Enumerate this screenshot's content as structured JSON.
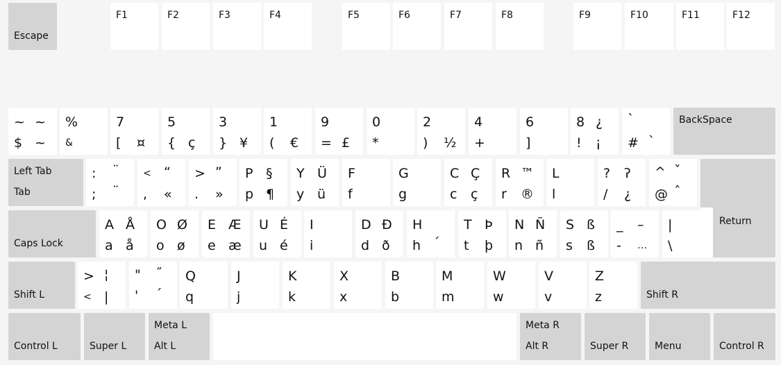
{
  "fkeys": {
    "escape": "Escape",
    "f1": "F1",
    "f2": "F2",
    "f3": "F3",
    "f4": "F4",
    "f5": "F5",
    "f6": "F6",
    "f7": "F7",
    "f8": "F8",
    "f9": "F9",
    "f10": "F10",
    "f11": "F11",
    "f12": "F12"
  },
  "row_number": {
    "k1": {
      "tl": "~",
      "tr": "~",
      "bl": "$",
      "br": "~"
    },
    "k2": {
      "tl": "%",
      "tr": "",
      "bl": "&",
      "br": ""
    },
    "k3": {
      "tl": "7",
      "tr": "",
      "bl": "[",
      "br": "¤"
    },
    "k4": {
      "tl": "5",
      "tr": "",
      "bl": "{",
      "br": "ç"
    },
    "k5": {
      "tl": "3",
      "tr": "",
      "bl": "}",
      "br": "¥"
    },
    "k6": {
      "tl": "1",
      "tr": "",
      "bl": "(",
      "br": "€"
    },
    "k7": {
      "tl": "9",
      "tr": "",
      "bl": "=",
      "br": "£"
    },
    "k8": {
      "tl": "0",
      "tr": "",
      "bl": "*",
      "br": ""
    },
    "k9": {
      "tl": "2",
      "tr": "",
      "bl": ")",
      "br": "½"
    },
    "k10": {
      "tl": "4",
      "tr": "",
      "bl": "+",
      "br": ""
    },
    "k11": {
      "tl": "6",
      "tr": "",
      "bl": "]",
      "br": ""
    },
    "k12": {
      "tl": "8",
      "tr": "¿",
      "bl": "!",
      "br": "¡"
    },
    "k13": {
      "tl": "`",
      "tr": "",
      "bl": "#",
      "br": "`"
    },
    "backspace": "BackSpace"
  },
  "row_top": {
    "tab_top": "Left Tab",
    "tab_bottom": "Tab",
    "k1": {
      "tl": ":",
      "tr": "¨",
      "bl": ";",
      "br": "¨"
    },
    "k2": {
      "tl": "<",
      "tr": "“",
      "bl": ",",
      "br": "«"
    },
    "k3": {
      "tl": ">",
      "tr": "”",
      "bl": ".",
      "br": "»"
    },
    "k4": {
      "tl": "P",
      "tr": "§",
      "bl": "p",
      "br": "¶"
    },
    "k5": {
      "tl": "Y",
      "tr": "Ü",
      "bl": "y",
      "br": "ü"
    },
    "k6": {
      "tl": "F",
      "tr": "",
      "bl": "f",
      "br": ""
    },
    "k7": {
      "tl": "G",
      "tr": "",
      "bl": "g",
      "br": ""
    },
    "k8": {
      "tl": "C",
      "tr": "Ç",
      "bl": "c",
      "br": "ç"
    },
    "k9": {
      "tl": "R",
      "tr": "™",
      "bl": "r",
      "br": "®"
    },
    "k10": {
      "tl": "L",
      "tr": "",
      "bl": "l",
      "br": ""
    },
    "k11": {
      "tl": "?",
      "tr": "ʔ",
      "bl": "/",
      "br": "¿"
    },
    "k12": {
      "tl": "^",
      "tr": "ˇ",
      "bl": "@",
      "br": "ˆ"
    }
  },
  "row_home": {
    "caps": "Caps Lock",
    "k1": {
      "tl": "A",
      "tr": "Å",
      "bl": "a",
      "br": "å"
    },
    "k2": {
      "tl": "O",
      "tr": "Ø",
      "bl": "o",
      "br": "ø"
    },
    "k3": {
      "tl": "E",
      "tr": "Æ",
      "bl": "e",
      "br": "æ"
    },
    "k4": {
      "tl": "U",
      "tr": "É",
      "bl": "u",
      "br": "é"
    },
    "k5": {
      "tl": "I",
      "tr": "",
      "bl": "i",
      "br": ""
    },
    "k6": {
      "tl": "D",
      "tr": "Đ",
      "bl": "d",
      "br": "ð"
    },
    "k7": {
      "tl": "H",
      "tr": "",
      "bl": "h",
      "br": "´"
    },
    "k8": {
      "tl": "T",
      "tr": "Þ",
      "bl": "t",
      "br": "þ"
    },
    "k9": {
      "tl": "N",
      "tr": "Ñ",
      "bl": "n",
      "br": "ñ"
    },
    "k10": {
      "tl": "S",
      "tr": "ß",
      "bl": "s",
      "br": "ß"
    },
    "k11": {
      "tl": "_",
      "tr": "–",
      "bl": "-",
      "br": "…"
    },
    "k12": {
      "tl": "|",
      "tr": "",
      "bl": "\\",
      "br": ""
    },
    "return": "Return"
  },
  "row_bottom": {
    "shift_l": "Shift L",
    "k1": {
      "tl": ">",
      "tr": "¦",
      "bl": "<",
      "br": "|"
    },
    "k2": {
      "tl": "\"",
      "tr": "˝",
      "bl": "'",
      "br": "´"
    },
    "k3": {
      "tl": "Q",
      "tr": "",
      "bl": "q",
      "br": ""
    },
    "k4": {
      "tl": "J",
      "tr": "",
      "bl": "j",
      "br": ""
    },
    "k5": {
      "tl": "K",
      "tr": "",
      "bl": "k",
      "br": ""
    },
    "k6": {
      "tl": "X",
      "tr": "",
      "bl": "x",
      "br": ""
    },
    "k7": {
      "tl": "B",
      "tr": "",
      "bl": "b",
      "br": ""
    },
    "k8": {
      "tl": "M",
      "tr": "",
      "bl": "m",
      "br": ""
    },
    "k9": {
      "tl": "W",
      "tr": "",
      "bl": "w",
      "br": ""
    },
    "k10": {
      "tl": "V",
      "tr": "",
      "bl": "v",
      "br": ""
    },
    "k11": {
      "tl": "Z",
      "tr": "",
      "bl": "z",
      "br": ""
    },
    "shift_r": "Shift R"
  },
  "row_space": {
    "control_l": "Control L",
    "super_l": "Super L",
    "meta_l": "Meta L",
    "alt_l": "Alt L",
    "meta_r": "Meta R",
    "alt_r": "Alt R",
    "super_r": "Super R",
    "menu": "Menu",
    "control_r": "Control R"
  }
}
